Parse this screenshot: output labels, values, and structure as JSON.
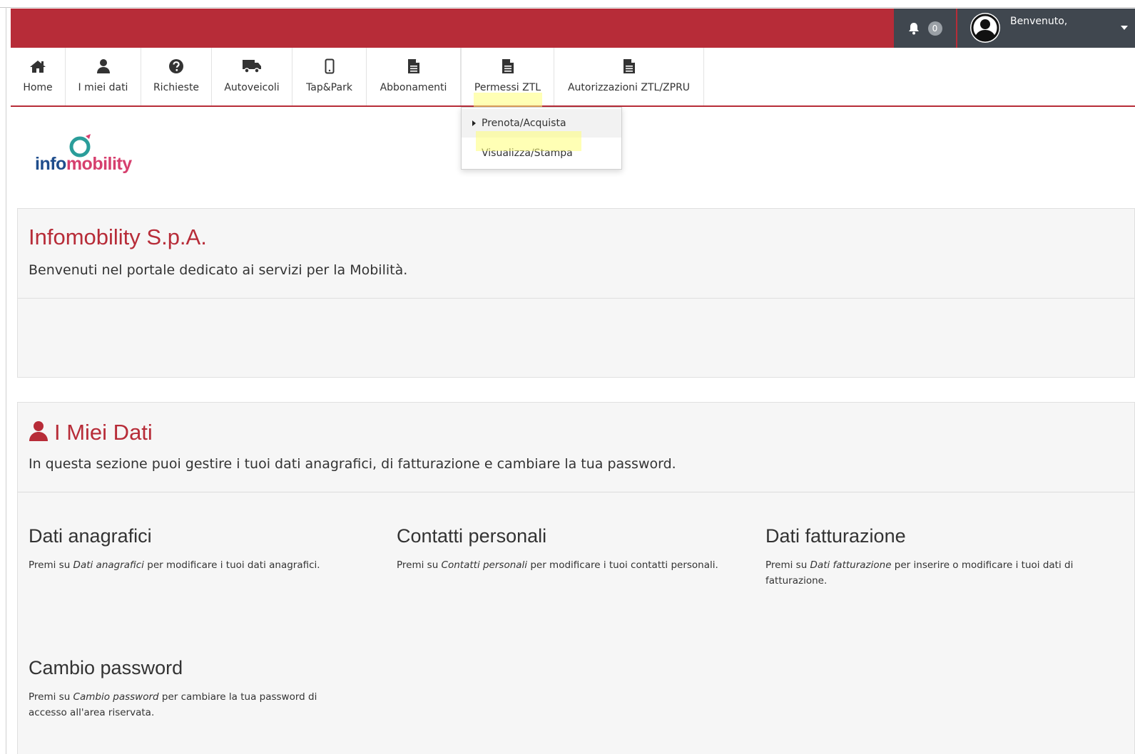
{
  "header": {
    "notification_count": "0",
    "welcome_text": "Benvenuto,",
    "accent_color": "#b72c38"
  },
  "nav": {
    "items": [
      {
        "label": "Home",
        "icon": "home-icon"
      },
      {
        "label": "I miei dati",
        "icon": "user-icon"
      },
      {
        "label": "Richieste",
        "icon": "question-icon"
      },
      {
        "label": "Autoveicoli",
        "icon": "truck-icon"
      },
      {
        "label": "Tap&Park",
        "icon": "mobile-icon"
      },
      {
        "label": "Abbonamenti",
        "icon": "document-icon"
      },
      {
        "label": "Permessi ZTL",
        "icon": "document-icon"
      },
      {
        "label": "Autorizzazioni ZTL/ZPRU",
        "icon": "document-icon"
      }
    ],
    "dropdown": {
      "items": [
        "Prenota/Acquista",
        "Visualizza/Stampa"
      ]
    }
  },
  "logo": {
    "part1": "info",
    "part2": "mobility"
  },
  "intro": {
    "title": "Infomobility S.p.A.",
    "subtitle": "Benvenuti nel portale dedicato ai servizi per la Mobilità."
  },
  "my_data": {
    "title": "I Miei Dati",
    "subtitle": "In questa sezione puoi gestire i tuoi dati anagrafici, di fatturazione e cambiare la tua password.",
    "cards": [
      {
        "title": "Dati anagrafici",
        "prefix": "Premi su ",
        "link": "Dati anagrafici",
        "suffix": " per modificare i tuoi dati anagrafici."
      },
      {
        "title": "Contatti personali",
        "prefix": "Premi su ",
        "link": "Contatti personali",
        "suffix": " per modificare i tuoi contatti personali."
      },
      {
        "title": "Dati fatturazione",
        "prefix": "Premi su ",
        "link": "Dati fatturazione",
        "suffix": " per inserire o modificare i tuoi dati di fatturazione."
      },
      {
        "title": "Cambio password",
        "prefix": "Premi su ",
        "link": "Cambio password",
        "suffix": " per cambiare la tua password di accesso all'area riservata."
      }
    ]
  }
}
